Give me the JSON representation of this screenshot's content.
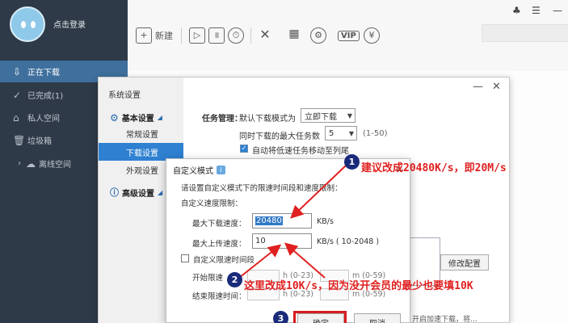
{
  "sidebar": {
    "login_text": "点击登录",
    "items": [
      {
        "label": "正在下载",
        "icon": "download-icon",
        "glyph": "⇩"
      },
      {
        "label": "已完成(1)",
        "icon": "check-circle-icon",
        "glyph": "✓"
      },
      {
        "label": "私人空间",
        "icon": "lock-icon",
        "glyph": "⌂"
      },
      {
        "label": "垃圾箱",
        "icon": "trash-icon",
        "glyph": "🗑"
      },
      {
        "label": "离线空间",
        "icon": "cloud-icon",
        "glyph": "☁"
      }
    ]
  },
  "toolbar": {
    "new_label": "新建",
    "vip_label": "VIP"
  },
  "settings": {
    "title": "系统设置",
    "basic_group": "基本设置",
    "items": [
      "常规设置",
      "下载设置",
      "外观设置"
    ],
    "advanced_group": "高级设置",
    "task_mgmt_label": "任务管理：",
    "default_mode_label": "默认下载模式为",
    "default_mode_value": "立即下载",
    "max_tasks_label": "同时下载的最大任务数",
    "max_tasks_value": "5",
    "max_tasks_range": "(1-50)",
    "auto_move_label": "自动将低速任务移动至列尾",
    "modify_config_label": "修改配置",
    "bottom_hint": "开启加速下载，将..."
  },
  "custom_dialog": {
    "title": "自定义模式",
    "instruction": "请设置自定义模式下的限速时间段和速度限制：",
    "speed_limit_label": "自定义速度限制：",
    "max_download_label": "最大下载速度：",
    "max_download_value": "20480",
    "max_download_unit": "KB/s",
    "max_upload_label": "最大上传速度：",
    "max_upload_value": "10",
    "max_upload_unit": "KB/s ( 10-2048 )",
    "time_period_label": "自定义限速时间段",
    "start_label": "开始限速",
    "end_label": "结束限速时间：",
    "hour_hint": "h (0-23)",
    "minute_hint": "m (0-59)",
    "ok_label": "确定",
    "cancel_label": "取消"
  },
  "annotations": {
    "badge1": "1",
    "note1": "建议改成20480K/s，即20M/s",
    "badge2": "2",
    "note2": "这里改成10K/s，因为没开会员的最少也要填10K",
    "badge3": "3"
  },
  "colors": {
    "sidebar_bg": "#2e3a47",
    "active_nav": "#3f6f9c",
    "settings_active": "#2f80d1",
    "annotation_red": "#e02020",
    "badge_blue": "#1a2a7a"
  }
}
